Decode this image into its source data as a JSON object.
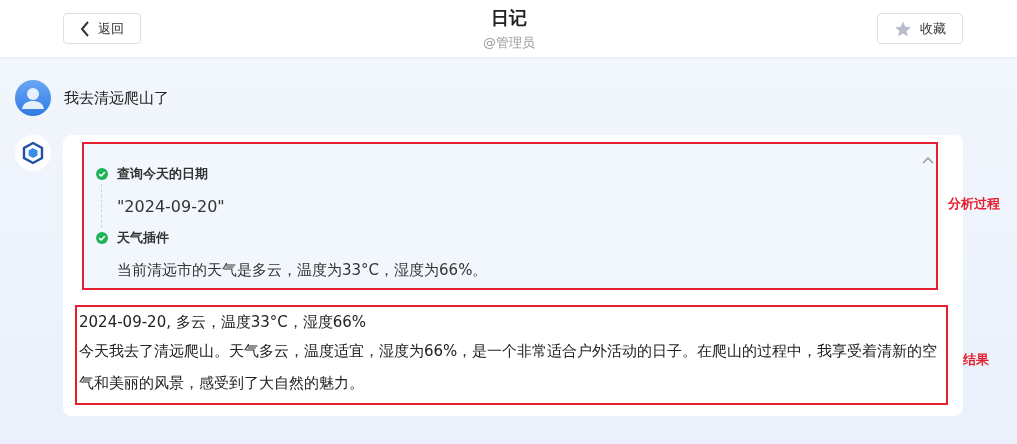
{
  "header": {
    "back_button": "返回",
    "title": "日记",
    "subtitle": "@管理员",
    "favorite_button": "收藏"
  },
  "user_message": {
    "text": "我去清远爬山了"
  },
  "assistant_message": {
    "process": {
      "expanded": true,
      "annotation": "分析过程",
      "steps": [
        {
          "title": "查询今天的日期",
          "done": true,
          "kind": "value",
          "output": "\"2024-09-20\""
        },
        {
          "title": "天气插件",
          "done": true,
          "kind": "text",
          "output": "当前清远市的天气是多云，温度为33°C，湿度为66%。"
        }
      ]
    },
    "result": {
      "annotation": "结果",
      "summary": "2024-09-20, 多云，温度33°C，湿度66%",
      "body": "今天我去了清远爬山。天气多云，温度适宜，湿度为66%，是一个非常适合户外活动的日子。在爬山的过程中，我享受着清新的空气和美丽的风景，感受到了大自然的魅力。"
    }
  }
}
